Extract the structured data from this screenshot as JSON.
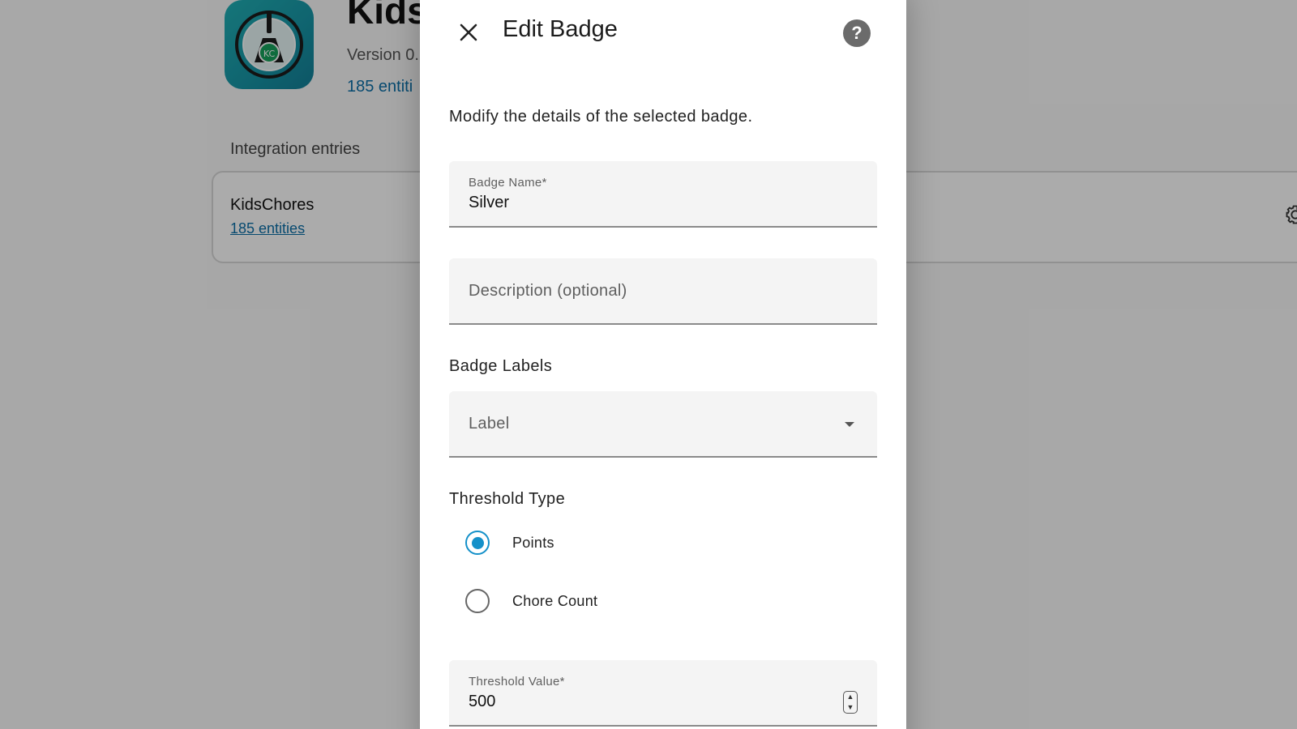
{
  "background": {
    "app_title": "Kids",
    "version": "Version 0.",
    "entities_link": "185 entiti",
    "section_title": "Integration entries",
    "card": {
      "title": "KidsChores",
      "entities": "185 entities"
    },
    "icon_badge": "KC"
  },
  "dialog": {
    "title": "Edit Badge",
    "description": "Modify the details of the selected badge.",
    "badge_name": {
      "label": "Badge Name*",
      "value": "Silver"
    },
    "description_field": {
      "placeholder": "Description (optional)"
    },
    "labels_section": "Badge Labels",
    "label_select": {
      "placeholder": "Label"
    },
    "threshold_section": "Threshold Type",
    "threshold_options": [
      {
        "label": "Points",
        "checked": true
      },
      {
        "label": "Chore Count",
        "checked": false
      }
    ],
    "threshold_value": {
      "label": "Threshold Value*",
      "value": "500"
    }
  },
  "colors": {
    "accent": "#1490c9",
    "app_icon": "#1a9bab",
    "link": "#0b6fa8"
  },
  "icons": {
    "close": "close-icon",
    "help": "help-icon",
    "dropdown": "chevron-down-icon",
    "settings": "gear-icon"
  }
}
